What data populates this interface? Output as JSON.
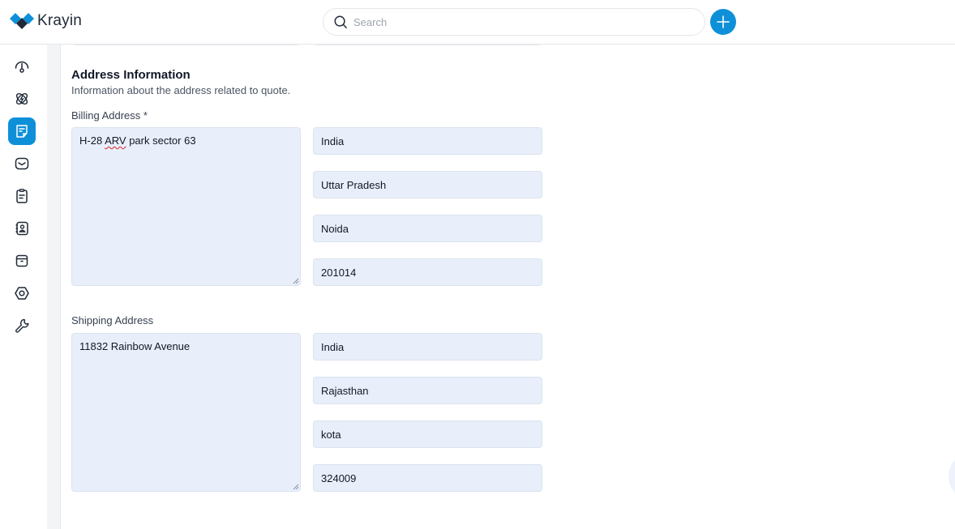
{
  "app": {
    "name": "Krayin"
  },
  "header": {
    "search_placeholder": "Search",
    "search_value": "",
    "add_button_icon": "plus-icon"
  },
  "colors": {
    "accent": "#0e90d9",
    "input_bg": "#e8effb",
    "main_bg": "#f3f4f6"
  },
  "sidebar": {
    "items": [
      {
        "name": "dashboard",
        "icon": "gauge-icon",
        "active": false
      },
      {
        "name": "leads",
        "icon": "atom-icon",
        "active": false
      },
      {
        "name": "quotes",
        "icon": "sticky-note-icon",
        "active": true
      },
      {
        "name": "mail",
        "icon": "mail-icon",
        "active": false
      },
      {
        "name": "activities",
        "icon": "clipboard-icon",
        "active": false
      },
      {
        "name": "contacts",
        "icon": "contact-book-icon",
        "active": false
      },
      {
        "name": "products",
        "icon": "archive-box-icon",
        "active": false
      },
      {
        "name": "settings",
        "icon": "hexagon-settings-icon",
        "active": false
      },
      {
        "name": "configuration",
        "icon": "wrench-icon",
        "active": false
      }
    ]
  },
  "section": {
    "title": "Address Information",
    "description": "Information about the address related to quote."
  },
  "billing": {
    "label": "Billing Address *",
    "address_prefix": "H-28 ",
    "address_misspelled": "ARV",
    "address_suffix": " park sector 63",
    "address": "H-28 ARV park sector 63",
    "country": "India",
    "state": "Uttar Pradesh",
    "city": "Noida",
    "postcode": "201014"
  },
  "shipping": {
    "label": "Shipping Address",
    "address": "11832 Rainbow Avenue",
    "country": "India",
    "state": "Rajasthan",
    "city": "kota",
    "postcode": "324009"
  }
}
